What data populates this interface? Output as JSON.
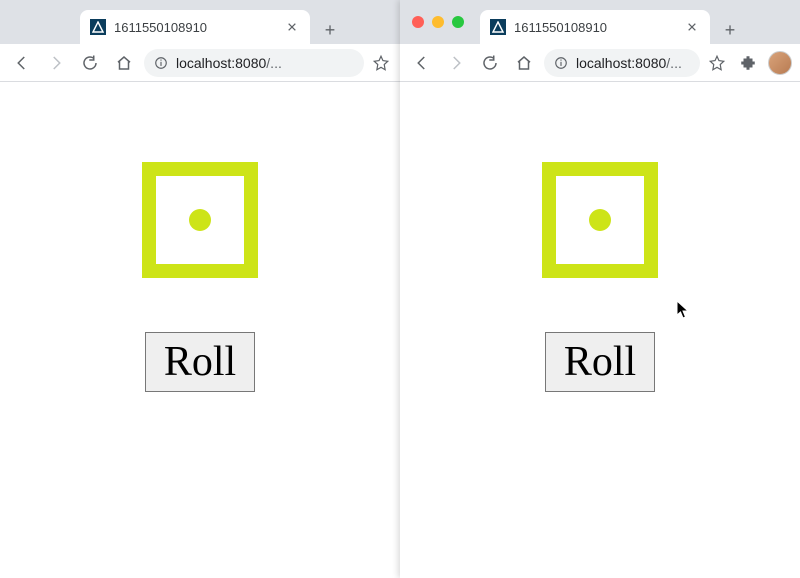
{
  "colors": {
    "dice_accent": "#cde417"
  },
  "windows": [
    {
      "id": "left",
      "show_traffic_lights": false,
      "tab_title": "1611550108910",
      "url_host": "localhost:8080",
      "url_path": "/...",
      "back_disabled": false,
      "forward_disabled": true,
      "show_extensions": false,
      "show_avatar": false,
      "dice_value": 1,
      "button_label": "Roll"
    },
    {
      "id": "right",
      "show_traffic_lights": true,
      "tab_title": "1611550108910",
      "url_host": "localhost:8080",
      "url_path": "/...",
      "back_disabled": false,
      "forward_disabled": true,
      "show_extensions": true,
      "show_avatar": true,
      "dice_value": 1,
      "button_label": "Roll"
    }
  ]
}
